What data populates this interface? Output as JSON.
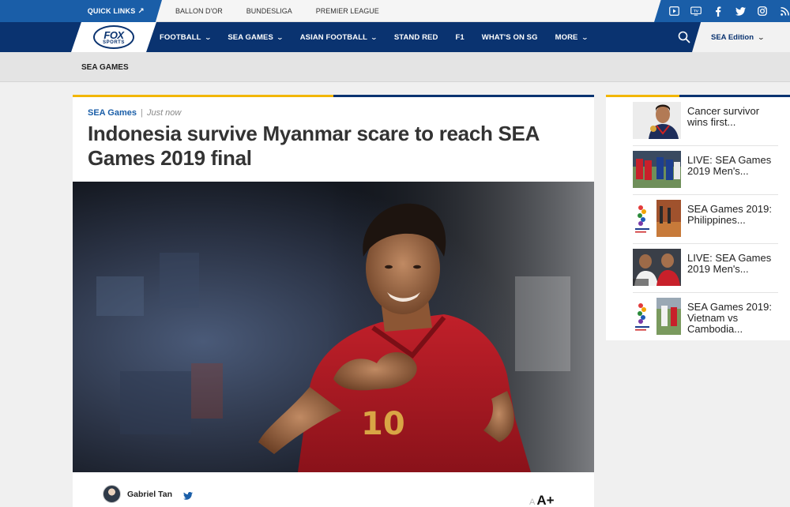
{
  "topbar": {
    "quick_links": "QUICK LINKS",
    "links": [
      "BALLON D'OR",
      "BUNDESLIGA",
      "PREMIER LEAGUE"
    ],
    "social_icons": [
      "video-icon",
      "tv-icon",
      "facebook-icon",
      "twitter-icon",
      "instagram-icon",
      "rss-icon"
    ]
  },
  "nav": {
    "logo_line1": "FOX",
    "logo_line2": "SPORTS",
    "items": [
      {
        "label": "FOOTBALL",
        "dropdown": true
      },
      {
        "label": "SEA GAMES",
        "dropdown": true
      },
      {
        "label": "ASIAN FOOTBALL",
        "dropdown": true
      },
      {
        "label": "STAND RED",
        "dropdown": false
      },
      {
        "label": "F1",
        "dropdown": false
      },
      {
        "label": "WHAT'S ON SG",
        "dropdown": false
      },
      {
        "label": "MORE",
        "dropdown": true
      }
    ],
    "edition": "SEA Edition"
  },
  "breadcrumb": "SEA GAMES",
  "article": {
    "category": "SEA Games",
    "separator": "|",
    "time": "Just now",
    "title": "Indonesia survive Myanmar scare to reach SEA Games 2019 final",
    "author": "Gabriel Tan",
    "font_small": "A",
    "font_big": "A+"
  },
  "sidebar": {
    "items": [
      {
        "title": "Cancer survivor wins first..."
      },
      {
        "title": "LIVE: SEA Games 2019 Men's..."
      },
      {
        "title": "SEA Games 2019: Philippines..."
      },
      {
        "title": "LIVE: SEA Games 2019 Men's..."
      },
      {
        "title": "SEA Games 2019: Vietnam vs Cambodia..."
      }
    ]
  },
  "colors": {
    "brand_blue": "#0a3370",
    "link_blue": "#1a5ea8",
    "accent_yellow": "#f2b600"
  }
}
